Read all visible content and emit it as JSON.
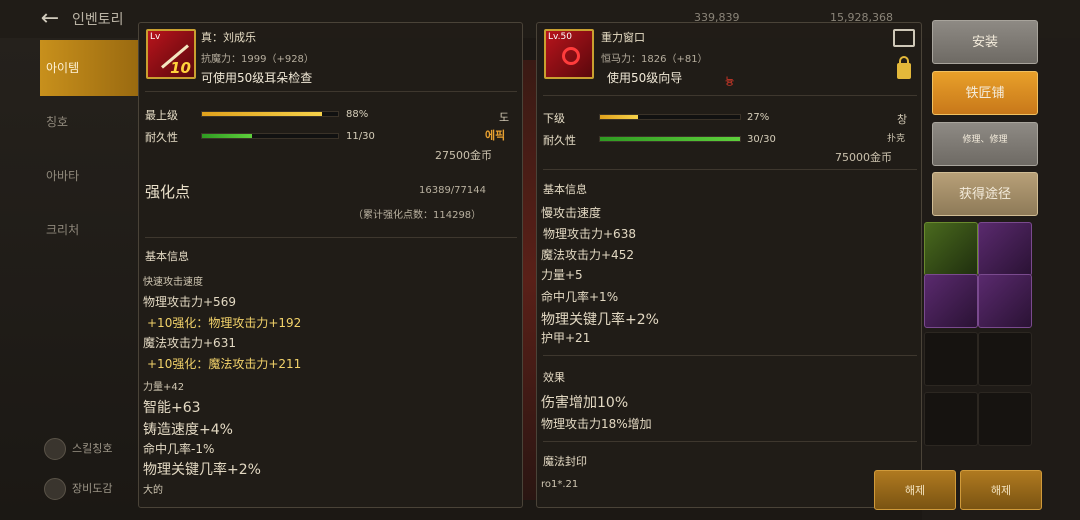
{
  "topbar": {
    "back_icon": "arrow-left-icon",
    "title": "인벤토리",
    "res1": "339,839",
    "res2": "15,928,368"
  },
  "left_tabs": [
    "아이템",
    "칭호",
    "아바타",
    "크리처"
  ],
  "left_bottom": [
    "스킬칭호",
    "장비도감"
  ],
  "left_panel": {
    "name": "真：刘成乐",
    "icon_level": "Lv",
    "icon_plus": "10",
    "sub": "抗魔力：1999（+928）",
    "usage": "可使用50级耳朵检查",
    "level_label": "最上级",
    "level_pct": 88,
    "level_text": "88%",
    "durability_label": "耐久性",
    "durability_value": 11,
    "durability_max": 30,
    "durability_text": "11/30",
    "grade_top": "도",
    "grade_bottom": "에픽",
    "price": "27500金币",
    "enhance_label": "强化点",
    "enhance_value": "16389/77144",
    "enhance_total": "（累计强化点数：114298）",
    "basic_title": "基本信息",
    "lines": [
      "快速攻击速度",
      "物理攻击力+569",
      "+10强化：物理攻击力+192",
      "魔法攻击力+631",
      "+10强化：魔法攻击力+211",
      "力量+42",
      "智能+63",
      "铸造速度+4%",
      "命中几率-1%",
      "物理关键几率+2%",
      "大的"
    ]
  },
  "right_panel": {
    "icon_level": "Lv.50",
    "name": "重力窗口",
    "sub": "恒马力：1826（+81）",
    "usage": "使用50级向导",
    "usage_red": "늉",
    "level_label": "下级",
    "level_pct": 27,
    "level_text": "27%",
    "durability_label": "耐久性",
    "durability_value": 30,
    "durability_max": 30,
    "durability_text": "30/30",
    "grade_top": "창",
    "grade_bottom": "扑克",
    "price": "75000金币",
    "basic_title": "基本信息",
    "lines": [
      "慢攻击速度",
      "物理攻击力+638",
      "魔法攻击力+452",
      "力量+5",
      "命中几率+1%",
      "物理关键几率+2%",
      "护甲+21"
    ],
    "effect_title": "效果",
    "effect_lines": [
      "伤害增加10%",
      "物理攻击力18%增加"
    ],
    "seal_title": "魔法封印",
    "seal_line": "ro1*.21"
  },
  "buttons": {
    "install": "安装",
    "smith": "铁匠铺",
    "repair": "修理、修理",
    "obtain": "获得途径",
    "bottom1": "해제",
    "bottom2": "해제"
  }
}
